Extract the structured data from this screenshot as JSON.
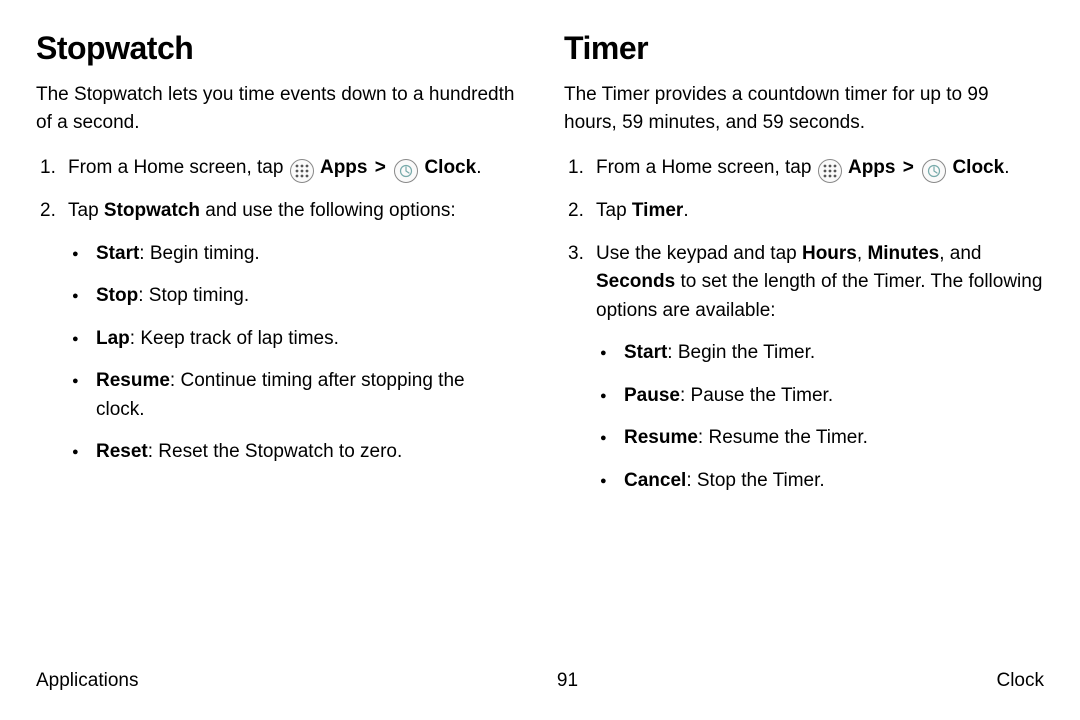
{
  "left": {
    "title": "Stopwatch",
    "intro": "The Stopwatch lets you time events down to a hundredth of a second.",
    "step1_prefix": "From a Home screen, tap ",
    "apps_label": "Apps",
    "chevron": ">",
    "clock_label": "Clock",
    "step2_prefix": "Tap ",
    "step2_bold": "Stopwatch",
    "step2_suffix": " and use the following options:",
    "options": [
      {
        "term": "Start",
        "desc": ": Begin timing."
      },
      {
        "term": "Stop",
        "desc": ": Stop timing."
      },
      {
        "term": "Lap",
        "desc": ": Keep track of lap times."
      },
      {
        "term": "Resume",
        "desc": ": Continue timing after stopping the clock."
      },
      {
        "term": "Reset",
        "desc": ": Reset the Stopwatch to zero."
      }
    ]
  },
  "right": {
    "title": "Timer",
    "intro": "The Timer provides a countdown timer for up to 99 hours, 59 minutes, and 59 seconds.",
    "step1_prefix": "From a Home screen, tap ",
    "apps_label": "Apps",
    "chevron": ">",
    "clock_label": "Clock",
    "step2_prefix": "Tap ",
    "step2_bold": "Timer",
    "step2_suffix": ".",
    "step3_a": "Use the keypad and tap ",
    "step3_b1": "Hours",
    "step3_c1": ", ",
    "step3_b2": "Minutes",
    "step3_c2": ", and ",
    "step3_b3": "Seconds",
    "step3_d": " to set the length of the Timer. The following options are available:",
    "options": [
      {
        "term": "Start",
        "desc": ": Begin the Timer."
      },
      {
        "term": "Pause",
        "desc": ": Pause the Timer."
      },
      {
        "term": "Resume",
        "desc": ": Resume the Timer."
      },
      {
        "term": "Cancel",
        "desc": ": Stop the Timer."
      }
    ]
  },
  "footer": {
    "left": "Applications",
    "center": "91",
    "right": "Clock"
  }
}
